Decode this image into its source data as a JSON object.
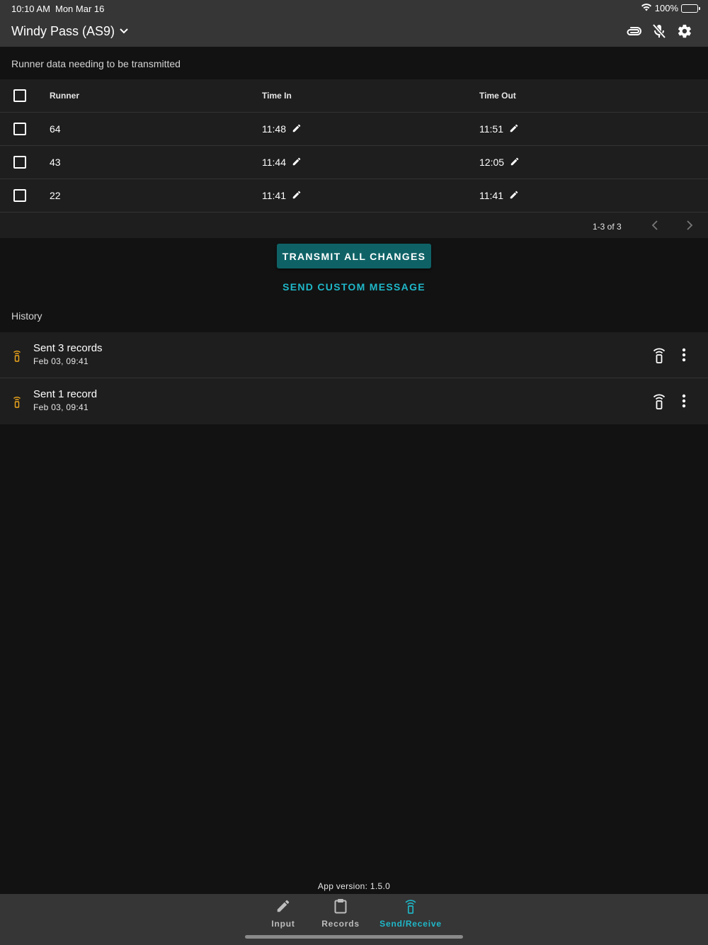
{
  "status_bar": {
    "time": "10:10 AM",
    "date": "Mon Mar 16",
    "battery": "100%"
  },
  "header": {
    "title": "Windy Pass (AS9)",
    "icons": [
      "link-icon",
      "mic-off-icon",
      "gear-icon"
    ]
  },
  "runner_section": {
    "label": "Runner data needing to be transmitted",
    "columns": {
      "runner": "Runner",
      "time_in": "Time In",
      "time_out": "Time Out"
    },
    "rows": [
      {
        "runner": "64",
        "time_in": "11:48",
        "time_out": "11:51"
      },
      {
        "runner": "43",
        "time_in": "11:44",
        "time_out": "12:05"
      },
      {
        "runner": "22",
        "time_in": "11:41",
        "time_out": "11:41"
      }
    ],
    "pagination": "1-3 of 3"
  },
  "actions": {
    "transmit_label": "TRANSMIT ALL CHANGES",
    "custom_label": "SEND CUSTOM MESSAGE",
    "transmit_color": "#0e6266",
    "accent_color": "#1fb8c9"
  },
  "history": {
    "label": "History",
    "icon_color": "#f0a81c",
    "items": [
      {
        "title": "Sent 3 records",
        "timestamp": "Feb 03, 09:41"
      },
      {
        "title": "Sent 1 record",
        "timestamp": "Feb 03, 09:41"
      }
    ]
  },
  "footer": {
    "version": "App version: 1.5.0"
  },
  "bottom_nav": {
    "items": [
      {
        "label": "Input",
        "icon": "pencil-icon"
      },
      {
        "label": "Records",
        "icon": "clipboard-icon"
      },
      {
        "label": "Send/Receive",
        "icon": "radio-tower-icon",
        "active": true
      }
    ]
  }
}
